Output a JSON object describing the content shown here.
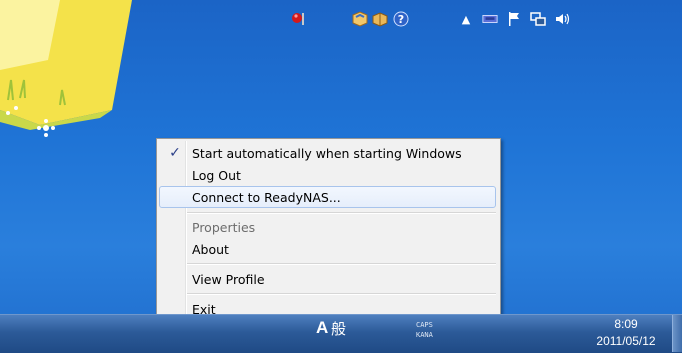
{
  "menu": {
    "items": [
      {
        "label": "Start automatically when starting Windows",
        "checked": true
      },
      {
        "label": "Log Out"
      },
      {
        "label": "Connect to ReadyNAS..."
      },
      {
        "label": "Properties",
        "disabled": true
      },
      {
        "label": "About"
      },
      {
        "label": "View Profile"
      },
      {
        "label": "Exit"
      }
    ]
  },
  "taskbar": {
    "ime_mode": "A",
    "ime_kanji": "般",
    "caps_label": "CAPS",
    "kana_label": "KANA",
    "clock_time": "8:09",
    "clock_date": "2011/05/12"
  },
  "icons": {
    "check": "checkmark-icon",
    "tray": [
      "red-pin-icon",
      "ime-pad-icon",
      "dictionary-icon",
      "help-icon",
      "show-hidden-icons-icon",
      "network-adapter-icon",
      "action-center-flag-icon",
      "network-icon",
      "volume-icon"
    ]
  },
  "colors": {
    "desktop": "#1f74d6",
    "taskbar": "#2c5a98",
    "menu_background": "#f1f1f1",
    "menu_hover": "#e6eefb"
  }
}
